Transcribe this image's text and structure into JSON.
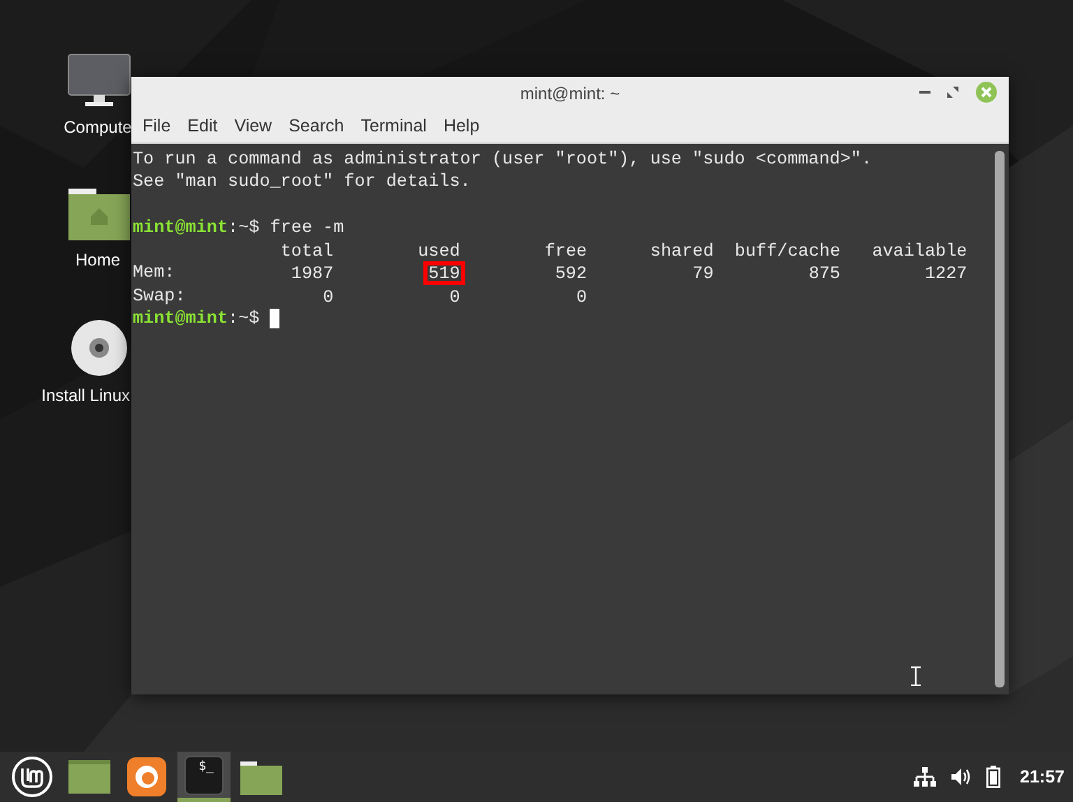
{
  "desktop_icons": [
    {
      "kind": "computer",
      "label": "Compute"
    },
    {
      "kind": "home",
      "label": "Home"
    },
    {
      "kind": "disc",
      "label": "Install Linux"
    }
  ],
  "window": {
    "title": "mint@mint: ~",
    "menu": [
      "File",
      "Edit",
      "View",
      "Search",
      "Terminal",
      "Help"
    ]
  },
  "terminal": {
    "lines": [
      {
        "kind": "text",
        "text": "To run a command as administrator (user \"root\"), use \"sudo <command>\"."
      },
      {
        "kind": "text",
        "text": "See \"man sudo_root\" for details."
      },
      {
        "kind": "blank"
      },
      {
        "kind": "prompt",
        "user": "mint@mint",
        "path": ":~$",
        "command": "free -m"
      },
      {
        "kind": "header",
        "cells": [
          "total",
          "used",
          "free",
          "shared",
          "buff/cache",
          "available"
        ]
      },
      {
        "kind": "row",
        "label": "Mem:",
        "cells": [
          {
            "text": "1987",
            "highlighted": false
          },
          {
            "text": "519",
            "highlighted": true
          },
          {
            "text": "592",
            "highlighted": false
          },
          {
            "text": "79",
            "highlighted": false
          },
          {
            "text": "875",
            "highlighted": false
          },
          {
            "text": "1227",
            "highlighted": false
          }
        ]
      },
      {
        "kind": "row",
        "label": "Swap:",
        "cells": [
          {
            "text": "0",
            "highlighted": false
          },
          {
            "text": "0",
            "highlighted": false
          },
          {
            "text": "0",
            "highlighted": false
          }
        ]
      },
      {
        "kind": "prompt",
        "user": "mint@mint",
        "path": ":~$",
        "cursor": true
      }
    ]
  },
  "taskbar": {
    "items": [
      {
        "kind": "menu",
        "selected": false
      },
      {
        "kind": "desktop",
        "selected": false
      },
      {
        "kind": "browser",
        "selected": false
      },
      {
        "kind": "terminal",
        "selected": true,
        "glyph": "$_"
      },
      {
        "kind": "files",
        "selected": false
      }
    ],
    "tray": [
      {
        "kind": "network"
      },
      {
        "kind": "volume"
      },
      {
        "kind": "battery"
      }
    ],
    "clock": "21:57"
  }
}
